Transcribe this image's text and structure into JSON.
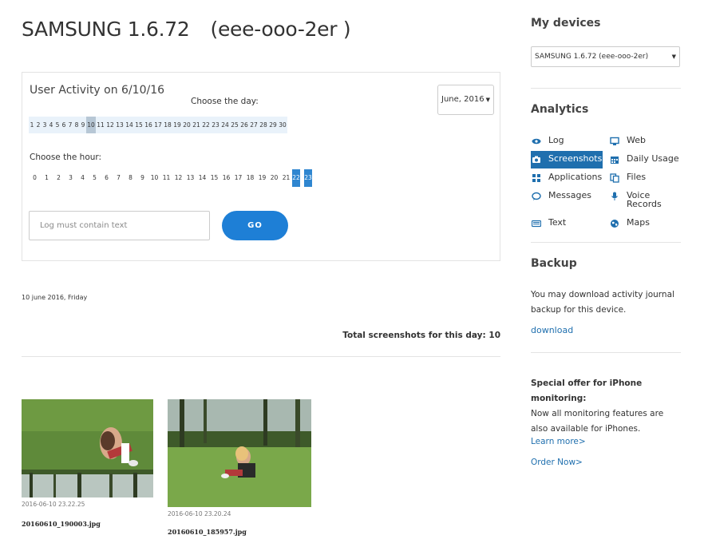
{
  "header": {
    "device_name": "SAMSUNG 1.6.72",
    "device_id": "(eee-ooo-2er )"
  },
  "activity": {
    "title": "User Activity on 6/10/16",
    "choose_day_label": "Choose the day:",
    "month_select_value": "June, 2016",
    "days": [
      "1",
      "2",
      "3",
      "4",
      "5",
      "6",
      "7",
      "8",
      "9",
      "10",
      "11",
      "12",
      "13",
      "14",
      "15",
      "16",
      "17",
      "18",
      "19",
      "20",
      "21",
      "22",
      "23",
      "24",
      "25",
      "26",
      "27",
      "28",
      "29",
      "30"
    ],
    "selected_day": "10",
    "choose_hour_label": "Choose the hour:",
    "hours": [
      "0",
      "1",
      "2",
      "3",
      "4",
      "5",
      "6",
      "7",
      "8",
      "9",
      "10",
      "11",
      "12",
      "13",
      "14",
      "15",
      "16",
      "17",
      "18",
      "19",
      "20",
      "21",
      "22",
      "23"
    ],
    "active_hours": [
      "22",
      "23"
    ],
    "log_input_placeholder": "Log must contain text",
    "go_label": "GO"
  },
  "results": {
    "day_heading": "10 june 2016, Friday",
    "total_label": "Total screenshots for this day: 10",
    "screenshots": [
      {
        "timestamp": "2016-06-10 23.22.25",
        "filename": "20160610_190003.jpg"
      },
      {
        "timestamp": "2016-06-10 23.20.24",
        "filename": "20160610_185957.jpg"
      }
    ]
  },
  "sidebar": {
    "my_devices_title": "My devices",
    "device_select_value": "SAMSUNG 1.6.72 (eee-ooo-2er)",
    "analytics_title": "Analytics",
    "nav": {
      "log": {
        "label": "Log",
        "icon": "eye-icon"
      },
      "web": {
        "label": "Web",
        "icon": "monitor-icon"
      },
      "screenshots": {
        "label": "Screenshots",
        "icon": "camera-icon"
      },
      "daily_usage": {
        "label": "Daily Usage",
        "icon": "calendar-icon"
      },
      "applications": {
        "label": "Applications",
        "icon": "grid-icon"
      },
      "files": {
        "label": "Files",
        "icon": "files-icon"
      },
      "messages": {
        "label": "Messages",
        "icon": "chat-bubble-icon"
      },
      "voice_records": {
        "label": "Voice Records",
        "icon": "microphone-icon"
      },
      "text": {
        "label": "Text",
        "icon": "keyboard-icon"
      },
      "maps": {
        "label": "Maps",
        "icon": "globe-icon"
      }
    },
    "backup_title": "Backup",
    "backup_text": "You may download activity journal backup for this device.",
    "backup_link": "download",
    "offer_title": "Special offer for iPhone monitoring:",
    "offer_text": "Now all monitoring features are also available for iPhones.",
    "learn_more_link": "Learn more>",
    "order_now_link": "Order Now>"
  },
  "colors": {
    "accent": "#1e7fd6",
    "active_nav": "#1f6fae",
    "day_strip_bg": "#e9f2fa",
    "selected_day_bg": "#b7c7d5",
    "active_hour_bg": "#2f86d0"
  }
}
